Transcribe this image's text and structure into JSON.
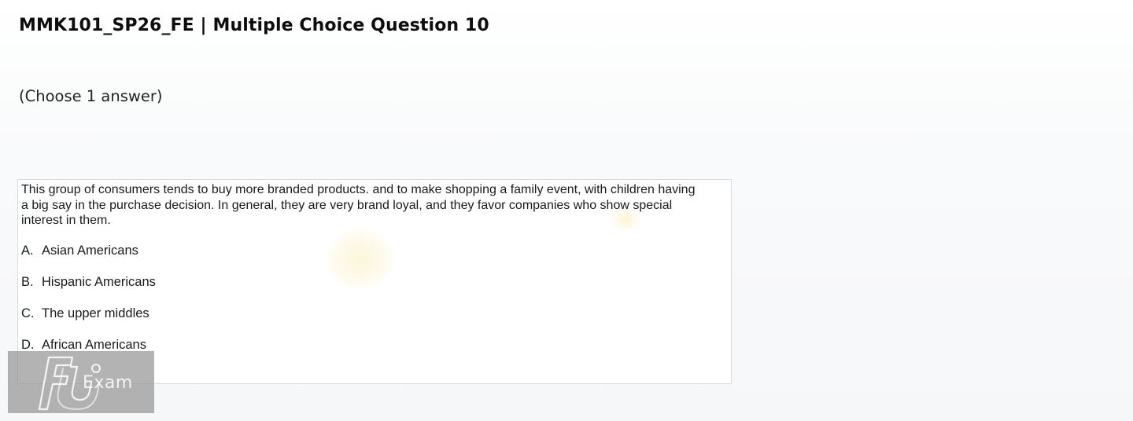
{
  "header": {
    "title": "MMK101_SP26_FE | Multiple Choice Question 10",
    "instruction": "(Choose 1 answer)"
  },
  "question": {
    "text": "This group of consumers tends to buy more branded products. and to make shopping a family event, with children having a big say in the purchase decision. In general, they are very brand loyal, and they favor companies who show special interest in them.",
    "options": [
      {
        "letter": "A.",
        "text": "Asian Americans"
      },
      {
        "letter": "B.",
        "text": "Hispanic Americans"
      },
      {
        "letter": "C.",
        "text": "The upper middles"
      },
      {
        "letter": "D.",
        "text": "African Americans"
      }
    ]
  },
  "watermark": {
    "logo_icon": "fu-logo-icon",
    "label": "Exam"
  }
}
